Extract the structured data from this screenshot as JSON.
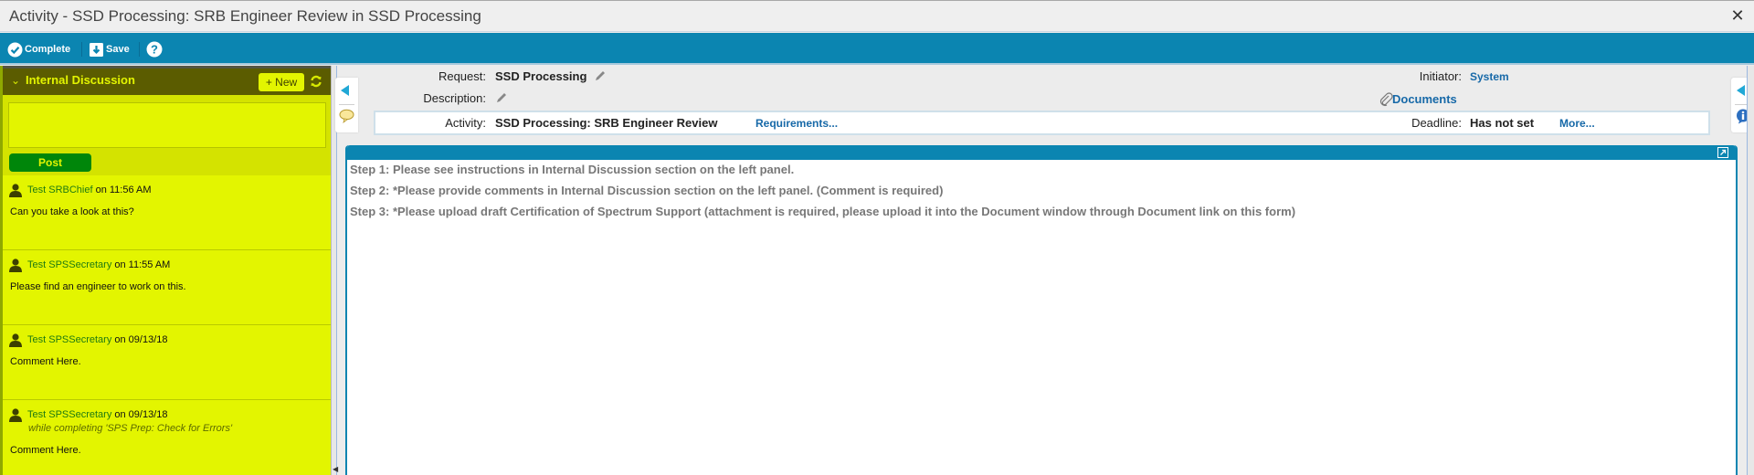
{
  "window": {
    "title": "Activity - SSD Processing: SRB Engineer Review in SSD Processing",
    "close_icon": "close-icon"
  },
  "toolbar": {
    "complete_label": "Complete",
    "save_label": "Save",
    "help_icon": "help-icon"
  },
  "discussion": {
    "title": "Internal Discussion",
    "new_label": "+ New",
    "compose_value": "",
    "post_label": "Post",
    "messages": [
      {
        "author": "Test SRBChief",
        "when": "on 11:56 AM",
        "context": "",
        "body": "Can you take a look at this?"
      },
      {
        "author": "Test SPSSecretary",
        "when": "on 11:55 AM",
        "context": "",
        "body": "Please find an engineer to work on this."
      },
      {
        "author": "Test SPSSecretary",
        "when": "on 09/13/18",
        "context": "",
        "body": "Comment Here."
      },
      {
        "author": "Test SPSSecretary",
        "when": "on 09/13/18",
        "context": "while completing 'SPS Prep: Check for Errors'",
        "body": "Comment Here."
      }
    ]
  },
  "header": {
    "request_label": "Request:",
    "request_value": "SSD Processing",
    "description_label": "Description:",
    "description_value": "",
    "activity_label": "Activity:",
    "activity_value": "SSD Processing: SRB Engineer Review",
    "requirements_link": "Requirements...",
    "initiator_label": "Initiator:",
    "initiator_value": "System",
    "documents_link": "Documents",
    "deadline_label": "Deadline:",
    "deadline_value": "Has not set",
    "more_link": "More..."
  },
  "instructions": {
    "steps": [
      "Step 1: Please see instructions in Internal Discussion section on the left panel.",
      "Step 2: *Please provide comments in Internal Discussion section on the left panel. (Comment is required)",
      "Step 3: *Please upload draft Certification of Spectrum Support (attachment is required, please upload it into the Document window through Document link on this form)"
    ]
  },
  "colors": {
    "toolbar_blue": "#0b85b1",
    "discussion_bg": "#e3f500",
    "discussion_header": "#5b5c00",
    "post_green": "#00860a",
    "link_blue": "#1769a8"
  }
}
